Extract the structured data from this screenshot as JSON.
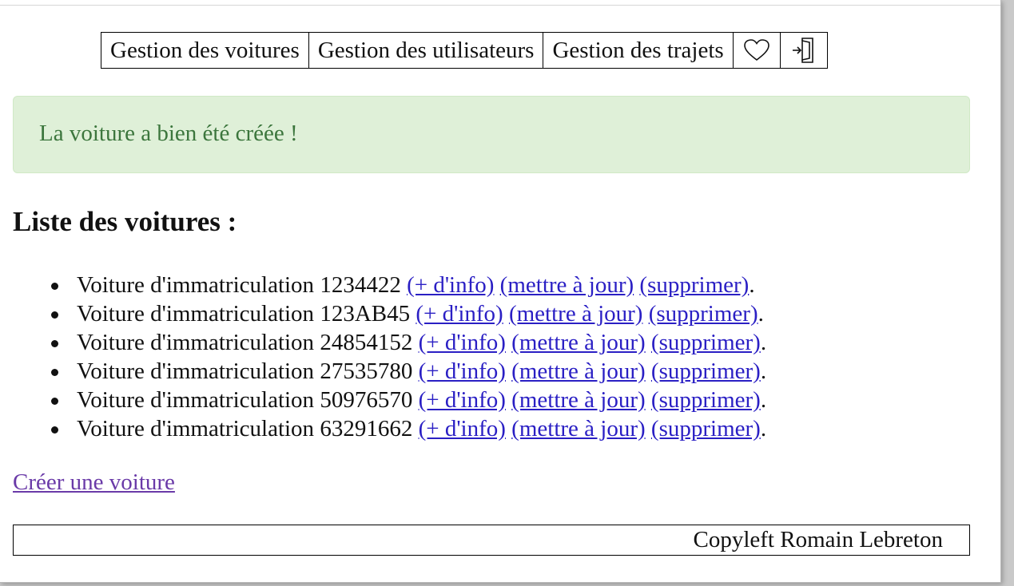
{
  "nav": {
    "items": [
      {
        "label": "Gestion des voitures"
      },
      {
        "label": "Gestion des utilisateurs"
      },
      {
        "label": "Gestion des trajets"
      }
    ],
    "icons": [
      "heart-icon",
      "logout-icon"
    ]
  },
  "alert": {
    "message": "La voiture a bien été créée !",
    "type": "success"
  },
  "list": {
    "title": "Liste des voitures :",
    "cars": [
      {
        "prefix": "Voiture d'immatriculation",
        "plate": "1234422",
        "info": "(+ d'info)",
        "update": "(mettre à jour)",
        "delete": "(supprimer)",
        "end": "."
      },
      {
        "prefix": "Voiture d'immatriculation",
        "plate": "123AB45",
        "info": "(+ d'info)",
        "update": "(mettre à jour)",
        "delete": "(supprimer)",
        "end": "."
      },
      {
        "prefix": "Voiture d'immatriculation",
        "plate": "24854152",
        "info": "(+ d'info)",
        "update": "(mettre à jour)",
        "delete": "(supprimer)",
        "end": "."
      },
      {
        "prefix": "Voiture d'immatriculation",
        "plate": "27535780",
        "info": "(+ d'info)",
        "update": "(mettre à jour)",
        "delete": "(supprimer)",
        "end": "."
      },
      {
        "prefix": "Voiture d'immatriculation",
        "plate": "50976570",
        "info": "(+ d'info)",
        "update": "(mettre à jour)",
        "delete": "(supprimer)",
        "end": "."
      },
      {
        "prefix": "Voiture d'immatriculation",
        "plate": "63291662",
        "info": "(+ d'info)",
        "update": "(mettre à jour)",
        "delete": "(supprimer)",
        "end": "."
      }
    ]
  },
  "create_link": "Créer une voiture",
  "footer": {
    "text": "Copyleft Romain Lebreton"
  },
  "colors": {
    "alert_bg": "#dff0d8",
    "alert_text": "#3c763d",
    "link": "#2a1fc4",
    "visited_link": "#6a3aa8"
  }
}
